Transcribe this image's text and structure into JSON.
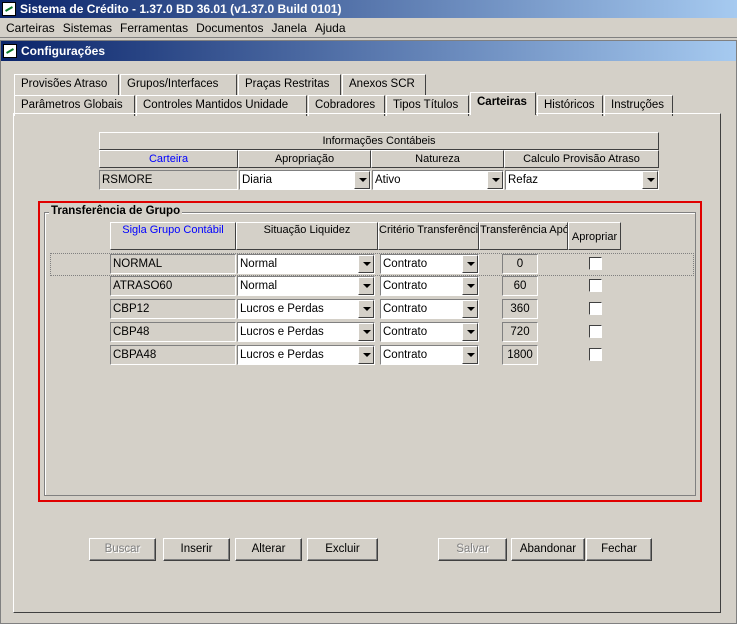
{
  "app": {
    "title": "Sistema de Crédito - 1.37.0 BD 36.01 (v1.37.0 Build 0101)"
  },
  "menu": [
    "Carteiras",
    "Sistemas",
    "Ferramentas",
    "Documentos",
    "Janela",
    "Ajuda"
  ],
  "window": {
    "title": "Configurações"
  },
  "tabs_row1": [
    "Provisões Atraso",
    "Grupos/Interfaces",
    "Praças Restritas",
    "Anexos SCR"
  ],
  "tabs_row2": [
    "Parâmetros Globais",
    "Controles Mantidos Unidade",
    "Cobradores",
    "Tipos Títulos",
    "Carteiras",
    "Históricos",
    "Instruções"
  ],
  "active_tab": "Carteiras",
  "contabeis": {
    "title": "Informações Contábeis",
    "headers": [
      "Carteira",
      "Apropriação",
      "Natureza",
      "Calculo Provisão Atraso"
    ],
    "row": {
      "carteira": "RSMORE",
      "apropriacao": "Diaria",
      "natureza": "Ativo",
      "calculo": "Refaz"
    }
  },
  "transferencia": {
    "title": "Transferência de Grupo",
    "headers": {
      "sigla": "Sigla Grupo Contábil",
      "situacao": "Situação Liquidez",
      "criterio": "Critério Transferência",
      "dias": "Transferência Após Dias Atraso",
      "apropriar": "Apropriar"
    },
    "rows": [
      {
        "sigla": "NORMAL",
        "situacao": "Normal",
        "criterio": "Contrato",
        "dias": "0",
        "apropriar": false
      },
      {
        "sigla": "ATRASO60",
        "situacao": "Normal",
        "criterio": "Contrato",
        "dias": "60",
        "apropriar": false
      },
      {
        "sigla": "CBP12",
        "situacao": "Lucros e Perdas",
        "criterio": "Contrato",
        "dias": "360",
        "apropriar": false
      },
      {
        "sigla": "CBP48",
        "situacao": "Lucros e Perdas",
        "criterio": "Contrato",
        "dias": "720",
        "apropriar": false
      },
      {
        "sigla": "CBPA48",
        "situacao": "Lucros e Perdas",
        "criterio": "Contrato",
        "dias": "1800",
        "apropriar": false
      }
    ]
  },
  "buttons": {
    "buscar": "Buscar",
    "inserir": "Inserir",
    "alterar": "Alterar",
    "excluir": "Excluir",
    "salvar": "Salvar",
    "abandonar": "Abandonar",
    "fechar": "Fechar"
  },
  "colors": {
    "title_start": "#0a246a",
    "title_end": "#a6caf0",
    "highlight_border": "#e00000",
    "header_blue": "#0000ff"
  }
}
